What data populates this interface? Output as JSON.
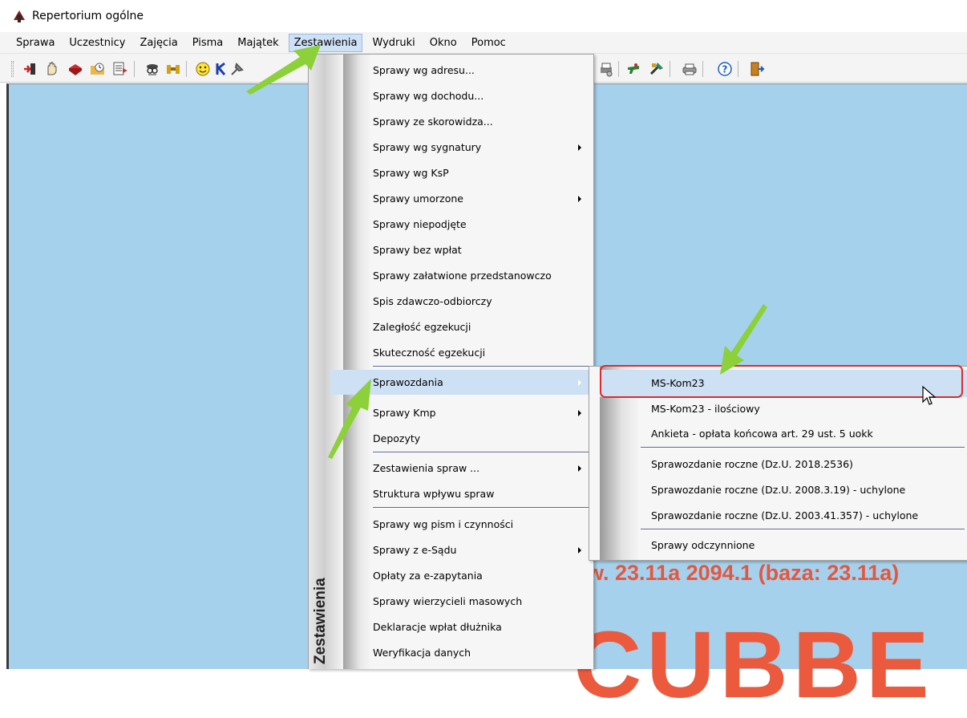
{
  "window": {
    "title": "Repertorium ogólne",
    "icon": "app-icon"
  },
  "menubar": [
    {
      "label": "Sprawa"
    },
    {
      "label": "Uczestnicy"
    },
    {
      "label": "Zajęcia"
    },
    {
      "label": "Pisma"
    },
    {
      "label": "Majątek"
    },
    {
      "label": "Zestawienia",
      "active": true
    },
    {
      "label": "Wydruki"
    },
    {
      "label": "Okno"
    },
    {
      "label": "Pomoc"
    }
  ],
  "zestawienia_menu": {
    "band_label": "Zestawienia",
    "items": [
      {
        "label": "Sprawy wg adresu..."
      },
      {
        "label": "Sprawy wg dochodu..."
      },
      {
        "label": "Sprawy ze skorowidza..."
      },
      {
        "label": "Sprawy wg sygnatury",
        "submenu": true
      },
      {
        "label": "Sprawy wg KsP"
      },
      {
        "label": "Sprawy umorzone",
        "submenu": true
      },
      {
        "label": "Sprawy niepodjęte"
      },
      {
        "label": "Sprawy bez wpłat"
      },
      {
        "label": "Sprawy załatwione przedstanowczo"
      },
      {
        "label": "Spis zdawczo-odbiorczy"
      },
      {
        "label": "Zaległość egzekucji"
      },
      {
        "label": "Skuteczność egzekucji"
      },
      {
        "label": "Sprawozdania",
        "submenu": true,
        "highlighted": true
      },
      {
        "label": "Sprawy Kmp",
        "submenu": true
      },
      {
        "label": "Depozyty"
      },
      {
        "label": "Zestawienia spraw ...",
        "submenu": true
      },
      {
        "label": "Struktura wpływu spraw"
      },
      {
        "label": "Sprawy wg pism i czynności"
      },
      {
        "label": "Sprawy z e-Sądu",
        "submenu": true
      },
      {
        "label": "Opłaty za e-zapytania"
      },
      {
        "label": "Sprawy wierzycieli masowych"
      },
      {
        "label": "Deklaracje wpłat dłużnika"
      },
      {
        "label": "Weryfikacja danych"
      }
    ]
  },
  "sprawozdania_menu": {
    "items": [
      {
        "label": "MS-Kom23",
        "highlighted": true
      },
      {
        "label": "MS-Kom23 - ilościowy"
      },
      {
        "label": "Ankieta - opłata końcowa art. 29 ust. 5 uokk"
      },
      {
        "label": "Sprawozdanie roczne (Dz.U. 2018.2536)"
      },
      {
        "label": "Sprawozdanie roczne (Dz.U. 2008.3.19) - uchylone"
      },
      {
        "label": "Sprawozdanie roczne (Dz.U. 2003.41.357) - uchylone"
      },
      {
        "label": "Sprawy odczynnione"
      }
    ]
  },
  "background": {
    "version_text": "w. 23.11a 2094.1 (baza: 23.11a)",
    "big_text": "CUBBE",
    "color": "#a6d1ec",
    "accent_text_color": "#e4573f"
  },
  "annotations": {
    "highlight_color": "#e02a2a",
    "arrow_color": "#8cd03a"
  },
  "toolbar_icons": [
    "door-enter-icon",
    "hand-icon",
    "book-icon",
    "folder-clock-icon",
    "list-check-icon",
    "spy-icon",
    "binoculars-icon",
    "smiley-icon",
    "k-icon",
    "settings-tool-icon",
    "printer-setup-icon",
    "gun-icon",
    "tools-icon",
    "print-icon",
    "help-icon",
    "exit-door-icon"
  ]
}
